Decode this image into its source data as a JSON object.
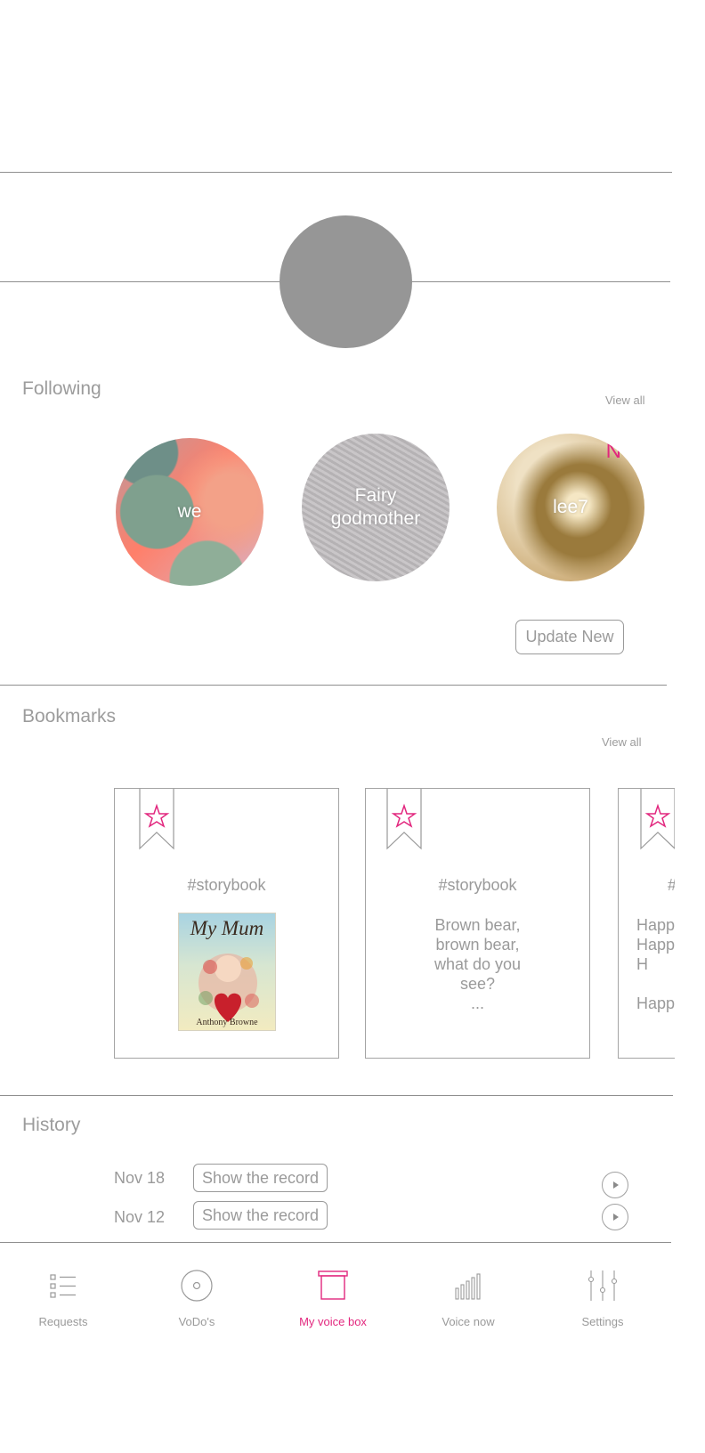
{
  "colors": {
    "accent": "#e2277e",
    "text": "#9a9a9a",
    "line": "#8f8f8f",
    "avatar_placeholder": "#969696"
  },
  "following": {
    "title": "Following",
    "view_all": "View all",
    "items": [
      {
        "name": "we",
        "is_new": false
      },
      {
        "name": "Fairy\ngodmother",
        "is_new": false
      },
      {
        "name": "lee7",
        "is_new": true,
        "badge": "N"
      }
    ],
    "update_button": "Update New"
  },
  "bookmarks": {
    "title": "Bookmarks",
    "view_all": "View all",
    "items": [
      {
        "tag": "#storybook",
        "cover": {
          "title": "My Mum",
          "author": "Anthony Browne"
        }
      },
      {
        "tag": "#storybook",
        "text": "Brown bear,\nbrown bear,\nwhat do you\nsee?\n..."
      },
      {
        "tag": "#",
        "text": "Happ\nHapp\nH\n\nHapp"
      }
    ]
  },
  "history": {
    "title": "History",
    "items": [
      {
        "date": "Nov 18",
        "button": "Show the record"
      },
      {
        "date": "Nov 12",
        "button": "Show the record"
      }
    ]
  },
  "bottom_nav": {
    "active": "My voice box",
    "items": [
      {
        "label": "Requests",
        "icon": "list-icon"
      },
      {
        "label": "VoDo's",
        "icon": "disc-icon"
      },
      {
        "label": "My voice box",
        "icon": "box-icon"
      },
      {
        "label": "Voice now",
        "icon": "bars-icon"
      },
      {
        "label": "Settings",
        "icon": "sliders-icon"
      }
    ]
  }
}
